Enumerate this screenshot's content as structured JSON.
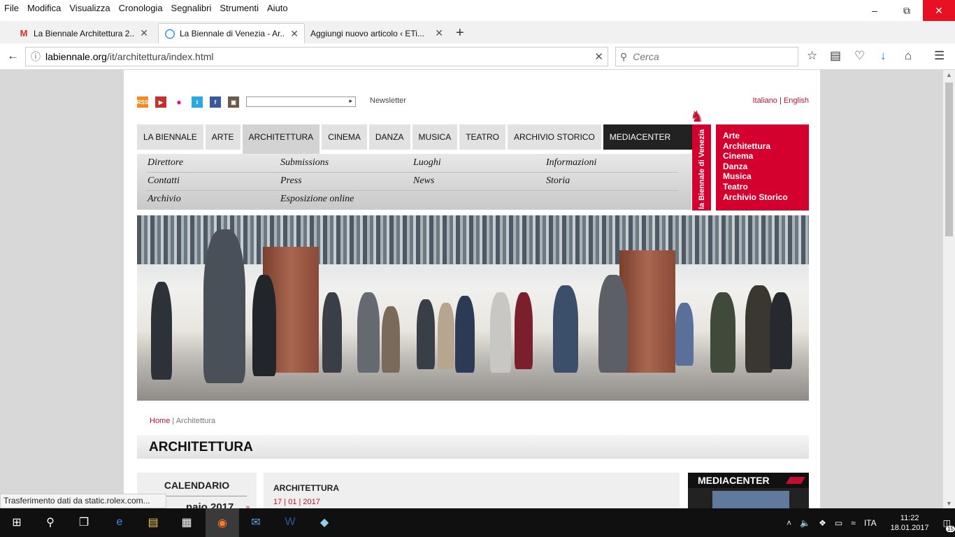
{
  "browser": {
    "menu": [
      "File",
      "Modifica",
      "Visualizza",
      "Cronologia",
      "Segnalibri",
      "Strumenti",
      "Aiuto"
    ],
    "tabs": [
      {
        "title": "La Biennale Architettura 2...",
        "icon": "gmail-icon"
      },
      {
        "title": "La Biennale di Venezia - Ar...",
        "icon": "loading-icon"
      },
      {
        "title": "Aggiungi nuovo articolo ‹ ETi...",
        "icon": "none"
      }
    ],
    "url_domain": "labiennale.org",
    "url_path": "/it/architettura/index.html",
    "search_placeholder": "Cerca",
    "status_text": "Trasferimento dati da static.rolex.com..."
  },
  "site": {
    "newsletter": "Newsletter",
    "lang_it": "Italiano",
    "lang_sep": "|",
    "lang_en": "English",
    "nav": [
      "La Biennale",
      "Arte",
      "Architettura",
      "Cinema",
      "Danza",
      "Musica",
      "Teatro",
      "Archivio Storico",
      "Mediacenter"
    ],
    "subnav": [
      [
        "Direttore",
        "Submissions",
        "Luoghi",
        "Informazioni"
      ],
      [
        "Contatti",
        "Press",
        "News",
        "Storia"
      ],
      [
        "Archivio",
        "Esposizione online"
      ]
    ],
    "logo_vertical": "la Biennale di Venezia",
    "logo_list": [
      "Arte",
      "Architettura",
      "Cinema",
      "Danza",
      "Musica",
      "Teatro",
      "Archivio Storico"
    ],
    "breadcrumb_home": "Home",
    "breadcrumb_sep": "|",
    "breadcrumb_current": "Architettura",
    "page_title": "ARCHITETTURA",
    "calendar_title": "CALENDARIO",
    "calendar_month": "naio 2017",
    "news_title": "ARCHITETTURA",
    "news_date": "17 | 01 | 2017",
    "mediacenter_title": "MEDIACENTER",
    "accent_color": "#c0102f"
  },
  "taskbar": {
    "lang": "ITA",
    "time": "11:22",
    "date": "18.01.2017",
    "notifications": "15"
  }
}
